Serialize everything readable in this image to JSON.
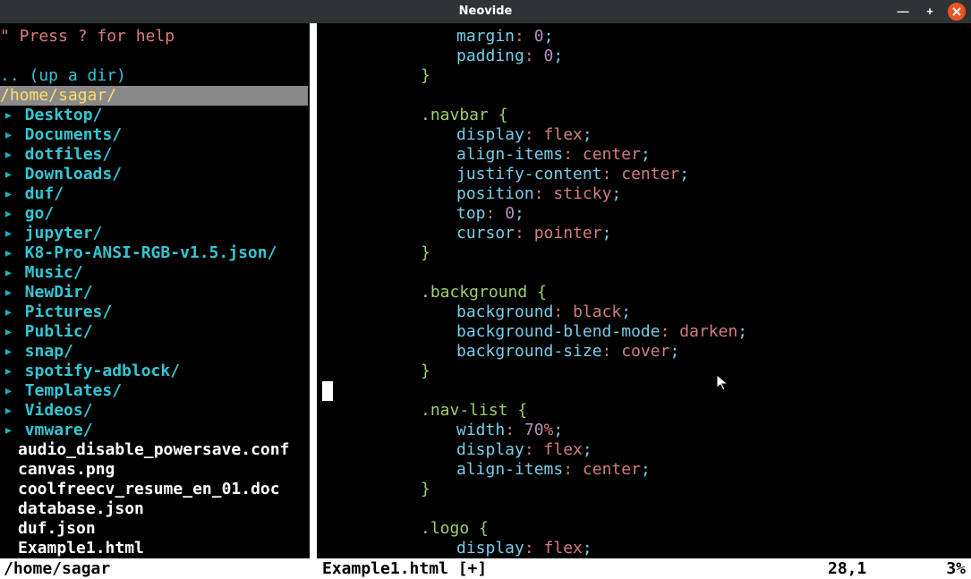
{
  "window": {
    "title": "Neovide"
  },
  "tree": {
    "help": "\" Press ? for help",
    "updir": ".. (up a dir)",
    "path": "/home/sagar/",
    "dirs": [
      "Desktop/",
      "Documents/",
      "dotfiles/",
      "Downloads/",
      "duf/",
      "go/",
      "jupyter/",
      "K8-Pro-ANSI-RGB-v1.5.json/",
      "Music/",
      "NewDir/",
      "Pictures/",
      "Public/",
      "snap/",
      "spotify-adblock/",
      "Templates/",
      "Videos/",
      "vmware/"
    ],
    "files": [
      "audio_disable_powersave.conf",
      "canvas.png",
      "coolfreecv_resume_en_01.doc",
      "database.json",
      "duf.json",
      "Example1.html"
    ]
  },
  "editor": {
    "lines": [
      {
        "t": "prop",
        "indent": 2,
        "prop": "margin",
        "val": "0",
        "num": true
      },
      {
        "t": "prop",
        "indent": 2,
        "prop": "padding",
        "val": "0",
        "num": true
      },
      {
        "t": "close",
        "indent": 1
      },
      {
        "t": "blank"
      },
      {
        "t": "open",
        "indent": 1,
        "sel": ".navbar"
      },
      {
        "t": "prop",
        "indent": 2,
        "prop": "display",
        "val": "flex"
      },
      {
        "t": "prop",
        "indent": 2,
        "prop": "align-items",
        "val": "center"
      },
      {
        "t": "prop",
        "indent": 2,
        "prop": "justify-content",
        "val": "center"
      },
      {
        "t": "prop",
        "indent": 2,
        "prop": "position",
        "val": "sticky"
      },
      {
        "t": "prop",
        "indent": 2,
        "prop": "top",
        "val": "0",
        "num": true
      },
      {
        "t": "prop",
        "indent": 2,
        "prop": "cursor",
        "val": "pointer"
      },
      {
        "t": "close",
        "indent": 1
      },
      {
        "t": "blank"
      },
      {
        "t": "open",
        "indent": 1,
        "sel": ".background"
      },
      {
        "t": "prop",
        "indent": 2,
        "prop": "background",
        "val": "black"
      },
      {
        "t": "prop",
        "indent": 2,
        "prop": "background-blend-mode",
        "val": "darken"
      },
      {
        "t": "prop",
        "indent": 2,
        "prop": "background-size",
        "val": "cover"
      },
      {
        "t": "close",
        "indent": 1
      },
      {
        "t": "blank"
      },
      {
        "t": "open",
        "indent": 1,
        "sel": ".nav-list"
      },
      {
        "t": "prop",
        "indent": 2,
        "prop": "width",
        "val": "70%",
        "num": true,
        "pct": true
      },
      {
        "t": "prop",
        "indent": 2,
        "prop": "display",
        "val": "flex"
      },
      {
        "t": "prop",
        "indent": 2,
        "prop": "align-items",
        "val": "center"
      },
      {
        "t": "close",
        "indent": 1
      },
      {
        "t": "blank"
      },
      {
        "t": "open",
        "indent": 1,
        "sel": ".logo"
      },
      {
        "t": "prop",
        "indent": 2,
        "prop": "display",
        "val": "flex"
      }
    ]
  },
  "status": {
    "left": "/home/sagar",
    "file": "Example1.html [+]",
    "pos": "28,1",
    "pct": "3%"
  }
}
